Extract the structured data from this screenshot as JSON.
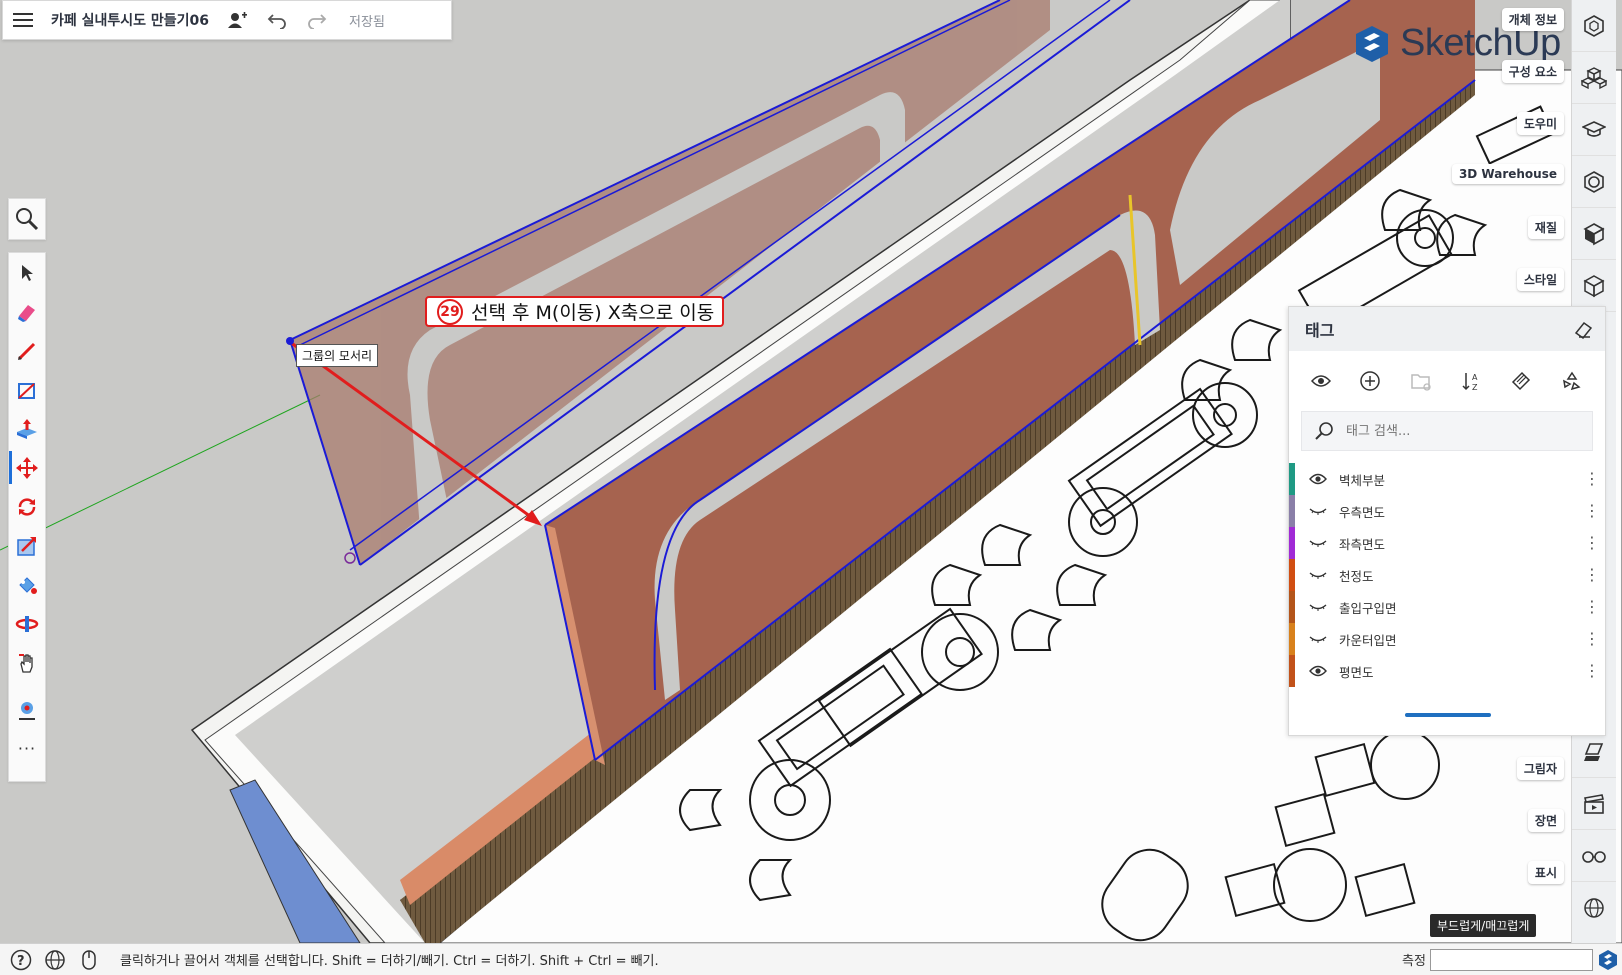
{
  "topbar": {
    "title": "카페 실내투시도 만들기06",
    "saved": "저장됨"
  },
  "logo": {
    "text": "SketchUp"
  },
  "right_panels": {
    "entity_info": "개체 정보",
    "components": "구성 요소",
    "instructor": "도우미",
    "warehouse": "3D Warehouse",
    "materials": "재질",
    "styles": "스타일",
    "shadows": "그림자",
    "scenes": "장면",
    "display": "표시"
  },
  "tags_panel": {
    "title": "태그",
    "search_placeholder": "태그 검색...",
    "tags": [
      {
        "name": "벽체부분",
        "visible": true,
        "color": "#1f9a84"
      },
      {
        "name": "우측면도",
        "visible": false,
        "color": "#8a7fa8"
      },
      {
        "name": "좌측면도",
        "visible": false,
        "color": "#a12ad6"
      },
      {
        "name": "천정도",
        "visible": false,
        "color": "#d14e12"
      },
      {
        "name": "출입구입면",
        "visible": false,
        "color": "#b4551a"
      },
      {
        "name": "카운터입면",
        "visible": false,
        "color": "#d8811c"
      },
      {
        "name": "평면도",
        "visible": true,
        "color": "#c2521a"
      }
    ]
  },
  "annotation": {
    "number": "29",
    "text": "선택 후 M(이동) X축으로 이동"
  },
  "inference_tip": "그룹의 모서리",
  "status": {
    "message": "클릭하거나 끌어서 객체를 선택합니다. Shift = 더하기/빼기. Ctrl = 더하기. Shift + Ctrl = 빼기.",
    "measure_label": "측정",
    "smooth_toggle": "부드럽게/매끄럽게"
  },
  "colors": {
    "accent": "#1e6fd9",
    "selection": "#1b1bd6",
    "annotation": "#e11d1d",
    "wood": "#a86a55"
  }
}
